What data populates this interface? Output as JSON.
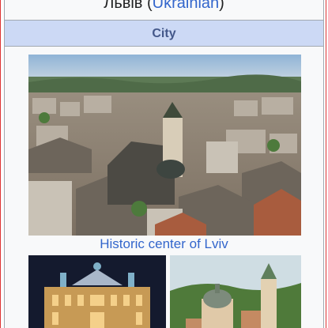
{
  "infobox": {
    "native_name": "Львів",
    "language_open": " (",
    "language": "Ukrainian",
    "language_close": ")",
    "section_title": "City",
    "main_image_caption": "Historic center of Lviv"
  },
  "colors": {
    "link": "#3366cc",
    "header_bg": "#ccd9f5",
    "header_text": "#44588a",
    "box_bg": "#f8f9fa",
    "border": "#a2a9b1",
    "outer_border": "#dd3333"
  },
  "images": [
    {
      "name": "historic-center-photo",
      "caption_ref": "main_image_caption"
    },
    {
      "name": "opera-theatre-night-photo"
    },
    {
      "name": "church-hill-photo"
    }
  ]
}
